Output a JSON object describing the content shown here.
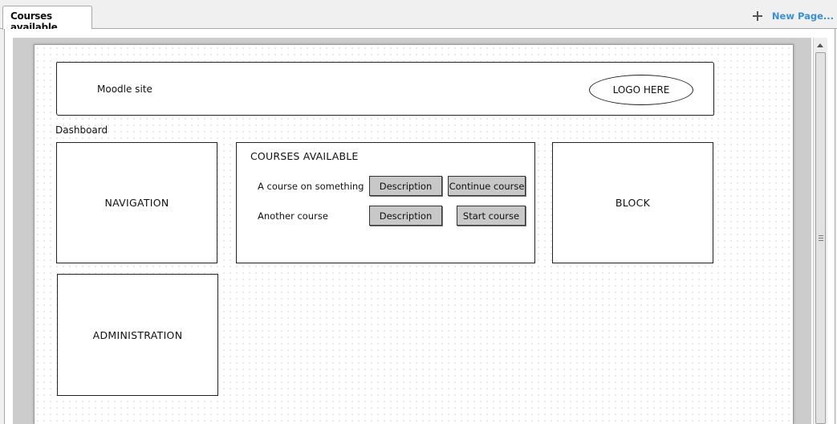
{
  "tab": {
    "label": "Courses available"
  },
  "toolbar": {
    "new_page_label": "New Page..."
  },
  "mockup": {
    "header": {
      "site_title": "Moodle site",
      "logo_text": "LOGO HERE"
    },
    "breadcrumb": "Dashboard",
    "navigation_label": "NAVIGATION",
    "administration_label": "ADMINISTRATION",
    "block_label": "BLOCK",
    "courses": {
      "title": "COURSES AVAILABLE",
      "items": [
        {
          "name": "A course on something",
          "description_label": "Description",
          "action_label": "Continue course"
        },
        {
          "name": "Another course",
          "description_label": "Description",
          "action_label": "Start course"
        }
      ]
    }
  }
}
